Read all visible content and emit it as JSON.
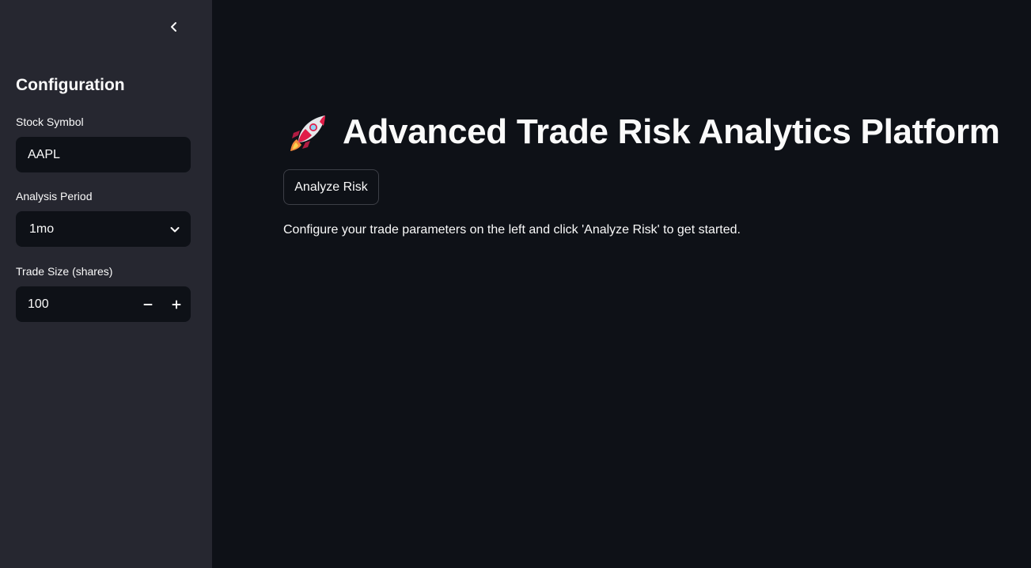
{
  "sidebar": {
    "title": "Configuration",
    "fields": {
      "symbol": {
        "label": "Stock Symbol",
        "value": "AAPL"
      },
      "period": {
        "label": "Analysis Period",
        "selected": "1mo"
      },
      "trade_size": {
        "label": "Trade Size (shares)",
        "value": "100"
      }
    }
  },
  "main": {
    "title": "Advanced Trade Risk Analytics Platform",
    "analyze_button": "Analyze Risk",
    "info": "Configure your trade parameters on the left and click 'Analyze Risk' to get started."
  },
  "icons": {
    "collapse": "chevron-left-icon",
    "period": "chevron-down-icon",
    "decrement": "minus-icon",
    "increment": "plus-icon",
    "title": "rocket-icon"
  },
  "colors": {
    "background": "#0e1117",
    "sidebar": "#262730",
    "text": "#fafafa",
    "button_border": "#3d3f47"
  }
}
